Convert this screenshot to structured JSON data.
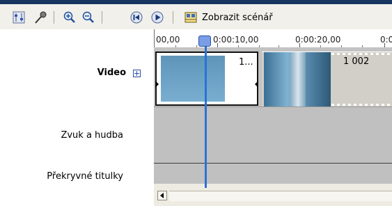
{
  "toolbar": {
    "buttons": [
      {
        "name": "set-audio-levels-icon"
      },
      {
        "name": "narrate-timeline-icon"
      },
      {
        "name": "zoom-in-icon"
      },
      {
        "name": "zoom-out-icon"
      },
      {
        "name": "rewind-timeline-icon"
      },
      {
        "name": "play-timeline-icon"
      }
    ],
    "storyboard_label": "Zobrazit scénář"
  },
  "ruler": {
    "ticks": [
      "00,00",
      "0:00:10,00",
      "0:00:20,00",
      "0:0"
    ]
  },
  "tracks": {
    "video_label": "Video",
    "audio_label": "Zvuk a hudba",
    "overlay_label": "Překryvné titulky"
  },
  "clips": [
    {
      "name": "1..."
    },
    {
      "name": "1 002"
    }
  ],
  "colors": {
    "playhead": "#2a72d8",
    "track_background": "#c3c3c3",
    "header_strip": "#16345f"
  }
}
